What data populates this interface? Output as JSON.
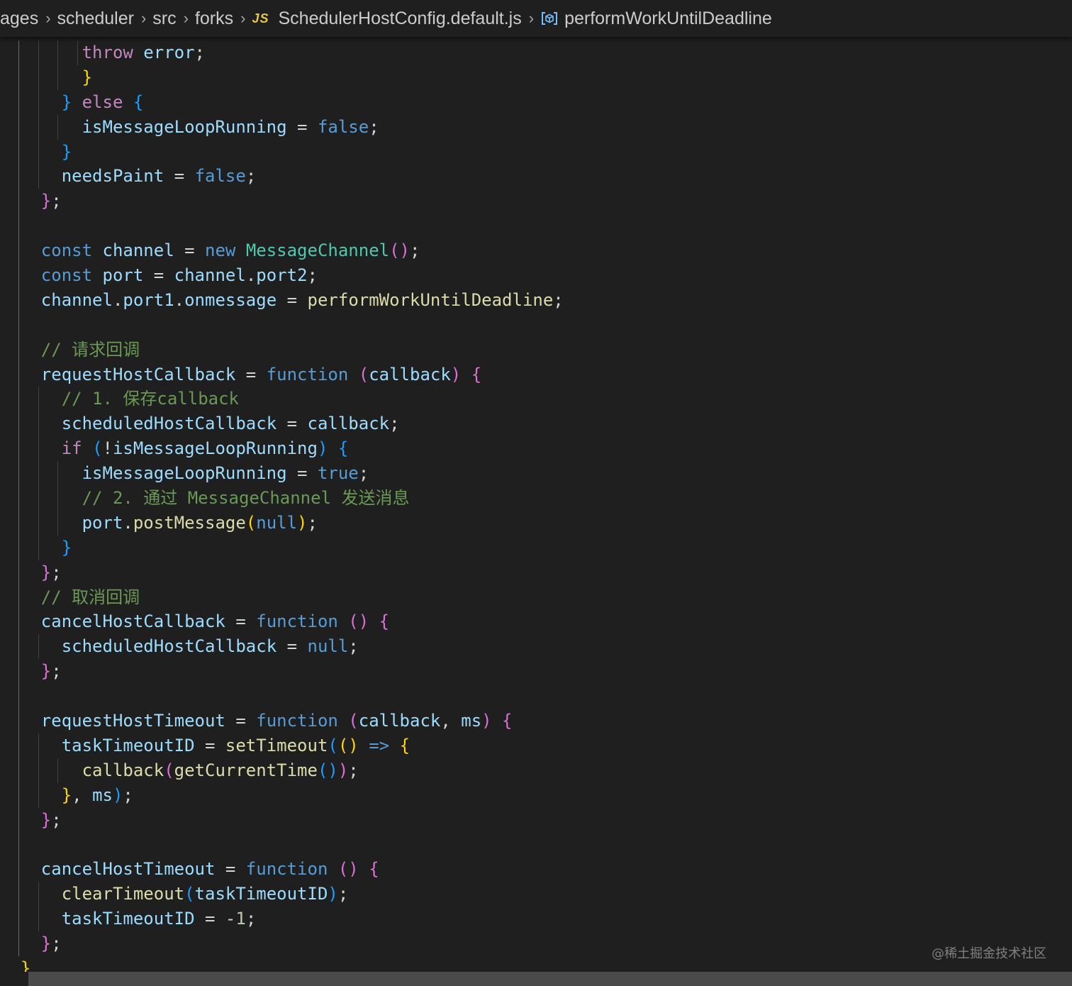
{
  "breadcrumb": {
    "items": [
      "ages",
      "scheduler",
      "src",
      "forks",
      "SchedulerHostConfig.default.js",
      "performWorkUntilDeadline"
    ],
    "file_icon": "JS",
    "symbol_icon": "symbol-variable-icon"
  },
  "colors": {
    "background": "#1f1f1f",
    "keyword": "#569cd6",
    "control": "#c586c0",
    "variable": "#9cdcfe",
    "function": "#dcdcaa",
    "class": "#4ec9b0",
    "number": "#b5cea8",
    "comment": "#6a9955",
    "bracket_1": "#ffd700",
    "bracket_2": "#da70d6",
    "bracket_3": "#179fff"
  },
  "code_lines": [
    [
      [
        "ctl",
        "throw "
      ],
      [
        "var",
        "error"
      ],
      [
        "op",
        ";"
      ]
    ],
    [
      [
        "b1",
        "}"
      ]
    ],
    [
      [
        "b3",
        "} "
      ],
      [
        "ctl",
        "else "
      ],
      [
        "b3",
        "{"
      ]
    ],
    [
      [
        "var",
        "isMessageLoopRunning"
      ],
      [
        "op",
        " = "
      ],
      [
        "kw",
        "false"
      ],
      [
        "op",
        ";"
      ]
    ],
    [
      [
        "b3",
        "}"
      ]
    ],
    [
      [
        "var",
        "needsPaint"
      ],
      [
        "op",
        " = "
      ],
      [
        "kw",
        "false"
      ],
      [
        "op",
        ";"
      ]
    ],
    [
      [
        "b2",
        "}"
      ],
      [
        "op",
        ";"
      ]
    ],
    [],
    [
      [
        "kw",
        "const "
      ],
      [
        "var",
        "channel"
      ],
      [
        "op",
        " = "
      ],
      [
        "kw",
        "new "
      ],
      [
        "cls",
        "MessageChannel"
      ],
      [
        "b2",
        "()"
      ],
      [
        "op",
        ";"
      ]
    ],
    [
      [
        "kw",
        "const "
      ],
      [
        "var",
        "port"
      ],
      [
        "op",
        " = "
      ],
      [
        "var",
        "channel"
      ],
      [
        "op",
        "."
      ],
      [
        "var",
        "port2"
      ],
      [
        "op",
        ";"
      ]
    ],
    [
      [
        "var",
        "channel"
      ],
      [
        "op",
        "."
      ],
      [
        "var",
        "port1"
      ],
      [
        "op",
        "."
      ],
      [
        "var",
        "onmessage"
      ],
      [
        "op",
        " = "
      ],
      [
        "fn",
        "performWorkUntilDeadline"
      ],
      [
        "op",
        ";"
      ]
    ],
    [],
    [
      [
        "com",
        "// 请求回调"
      ]
    ],
    [
      [
        "var",
        "requestHostCallback"
      ],
      [
        "op",
        " = "
      ],
      [
        "kw",
        "function "
      ],
      [
        "b2",
        "("
      ],
      [
        "var",
        "callback"
      ],
      [
        "b2",
        ") {"
      ]
    ],
    [
      [
        "com",
        "// 1. 保存callback"
      ]
    ],
    [
      [
        "var",
        "scheduledHostCallback"
      ],
      [
        "op",
        " = "
      ],
      [
        "var",
        "callback"
      ],
      [
        "op",
        ";"
      ]
    ],
    [
      [
        "ctl",
        "if "
      ],
      [
        "b3",
        "("
      ],
      [
        "op",
        "!"
      ],
      [
        "var",
        "isMessageLoopRunning"
      ],
      [
        "b3",
        ") {"
      ]
    ],
    [
      [
        "var",
        "isMessageLoopRunning"
      ],
      [
        "op",
        " = "
      ],
      [
        "kw",
        "true"
      ],
      [
        "op",
        ";"
      ]
    ],
    [
      [
        "com",
        "// 2. 通过 MessageChannel 发送消息"
      ]
    ],
    [
      [
        "var",
        "port"
      ],
      [
        "op",
        "."
      ],
      [
        "fn",
        "postMessage"
      ],
      [
        "b1",
        "("
      ],
      [
        "kw",
        "null"
      ],
      [
        "b1",
        ")"
      ],
      [
        "op",
        ";"
      ]
    ],
    [
      [
        "b3",
        "}"
      ]
    ],
    [
      [
        "b2",
        "}"
      ],
      [
        "op",
        ";"
      ]
    ],
    [
      [
        "com",
        "// 取消回调"
      ]
    ],
    [
      [
        "var",
        "cancelHostCallback"
      ],
      [
        "op",
        " = "
      ],
      [
        "kw",
        "function "
      ],
      [
        "b2",
        "() {"
      ]
    ],
    [
      [
        "var",
        "scheduledHostCallback"
      ],
      [
        "op",
        " = "
      ],
      [
        "kw",
        "null"
      ],
      [
        "op",
        ";"
      ]
    ],
    [
      [
        "b2",
        "}"
      ],
      [
        "op",
        ";"
      ]
    ],
    [],
    [
      [
        "var",
        "requestHostTimeout"
      ],
      [
        "op",
        " = "
      ],
      [
        "kw",
        "function "
      ],
      [
        "b2",
        "("
      ],
      [
        "var",
        "callback"
      ],
      [
        "op",
        ", "
      ],
      [
        "var",
        "ms"
      ],
      [
        "b2",
        ") {"
      ]
    ],
    [
      [
        "var",
        "taskTimeoutID"
      ],
      [
        "op",
        " = "
      ],
      [
        "fn",
        "setTimeout"
      ],
      [
        "b3",
        "("
      ],
      [
        "b1",
        "() "
      ],
      [
        "kw",
        "=> "
      ],
      [
        "b1",
        "{"
      ]
    ],
    [
      [
        "fn",
        "callback"
      ],
      [
        "b2",
        "("
      ],
      [
        "fn",
        "getCurrentTime"
      ],
      [
        "b3",
        "()"
      ],
      [
        "b2",
        ")"
      ],
      [
        "op",
        ";"
      ]
    ],
    [
      [
        "b1",
        "}"
      ],
      [
        "op",
        ", "
      ],
      [
        "var",
        "ms"
      ],
      [
        "b3",
        ")"
      ],
      [
        "op",
        ";"
      ]
    ],
    [
      [
        "b2",
        "}"
      ],
      [
        "op",
        ";"
      ]
    ],
    [],
    [
      [
        "var",
        "cancelHostTimeout"
      ],
      [
        "op",
        " = "
      ],
      [
        "kw",
        "function "
      ],
      [
        "b2",
        "() {"
      ]
    ],
    [
      [
        "fn",
        "clearTimeout"
      ],
      [
        "b3",
        "("
      ],
      [
        "var",
        "taskTimeoutID"
      ],
      [
        "b3",
        ")"
      ],
      [
        "op",
        ";"
      ]
    ],
    [
      [
        "var",
        "taskTimeoutID"
      ],
      [
        "op",
        " = "
      ],
      [
        "op",
        "-"
      ],
      [
        "num",
        "1"
      ],
      [
        "op",
        ";"
      ]
    ],
    [
      [
        "b2",
        "}"
      ],
      [
        "op",
        ";"
      ]
    ],
    [
      [
        "b1",
        "}"
      ]
    ]
  ],
  "watermark": "@稀土掘金技术社区"
}
